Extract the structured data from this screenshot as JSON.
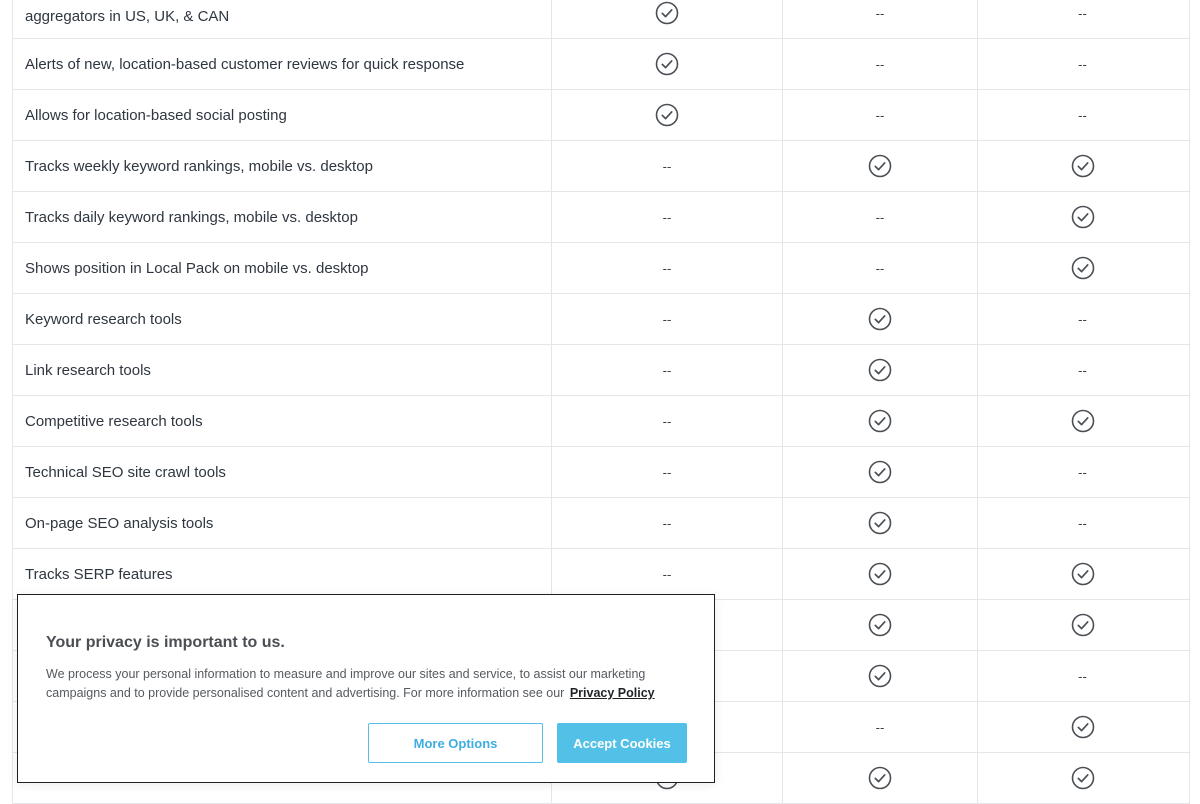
{
  "table": {
    "rows": [
      {
        "feature": "aggregators in US, UK, & CAN",
        "a": "check",
        "b": "--",
        "c": "--"
      },
      {
        "feature": "Alerts of new, location-based customer reviews for quick response",
        "a": "check",
        "b": "--",
        "c": "--"
      },
      {
        "feature": "Allows for location-based social posting",
        "a": "check",
        "b": "--",
        "c": "--"
      },
      {
        "feature": "Tracks weekly keyword rankings, mobile vs. desktop",
        "a": "--",
        "b": "check",
        "c": "check"
      },
      {
        "feature": "Tracks daily keyword rankings, mobile vs. desktop",
        "a": "--",
        "b": "--",
        "c": "check"
      },
      {
        "feature": "Shows position in Local Pack on mobile vs. desktop",
        "a": "--",
        "b": "--",
        "c": "check"
      },
      {
        "feature": "Keyword research tools",
        "a": "--",
        "b": "check",
        "c": "--"
      },
      {
        "feature": "Link research tools",
        "a": "--",
        "b": "check",
        "c": "--"
      },
      {
        "feature": "Competitive research tools",
        "a": "--",
        "b": "check",
        "c": "check"
      },
      {
        "feature": "Technical SEO site crawl tools",
        "a": "--",
        "b": "check",
        "c": "--"
      },
      {
        "feature": "On-page SEO analysis tools",
        "a": "--",
        "b": "check",
        "c": "--"
      },
      {
        "feature": "Tracks SERP features",
        "a": "--",
        "b": "check",
        "c": "check"
      },
      {
        "feature": "",
        "a": "",
        "b": "check",
        "c": "check"
      },
      {
        "feature": "",
        "a": "",
        "b": "check",
        "c": "--"
      },
      {
        "feature": "",
        "a": "",
        "b": "--",
        "c": "check"
      },
      {
        "feature": "",
        "a": "check",
        "b": "check",
        "c": "check"
      }
    ],
    "icons": {
      "check": "check-circle-icon"
    }
  },
  "cookie": {
    "title": "Your privacy is important to us.",
    "text": "We process your personal information to measure and improve our sites and service, to assist our marketing campaigns and to provide personalised content and advertising. For more information see our",
    "link": "Privacy Policy",
    "more_options": "More Options",
    "accept": "Accept Cookies",
    "accent_color": "#53c0e8"
  }
}
